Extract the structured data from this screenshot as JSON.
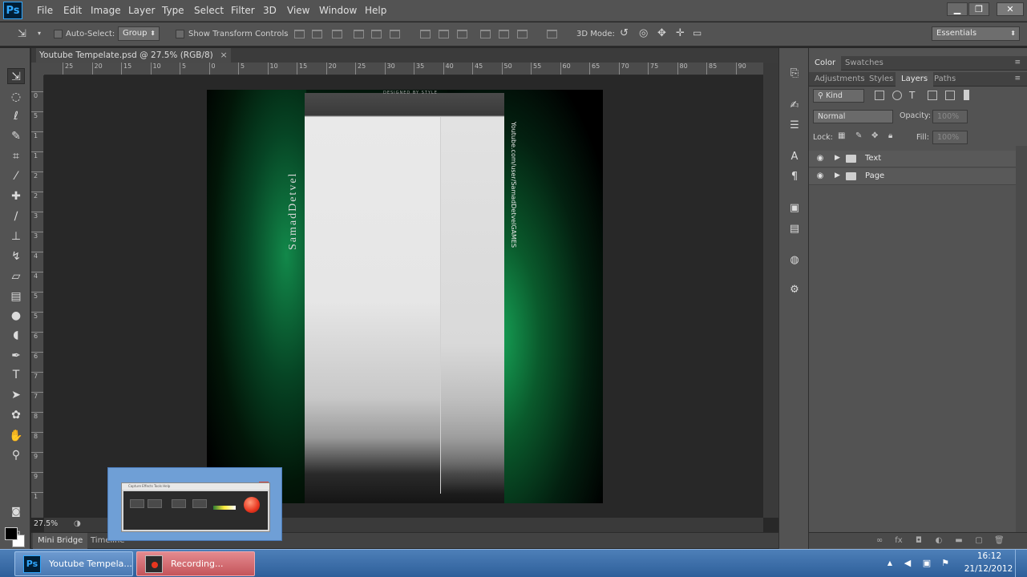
{
  "app": {
    "logo": "Ps"
  },
  "menu": [
    "File",
    "Edit",
    "Image",
    "Layer",
    "Type",
    "Select",
    "Filter",
    "3D",
    "View",
    "Window",
    "Help"
  ],
  "window_controls": {
    "minimize": "▁",
    "restore": "❐",
    "close": "✕"
  },
  "options_bar": {
    "auto_select_label": "Auto-Select:",
    "auto_select_value": "Group",
    "show_transform_label": "Show Transform Controls",
    "mode_3d_label": "3D Mode:",
    "workspace": "Essentials"
  },
  "document": {
    "tab_title": "Youtube Tempelate.psd @ 27.5% (RGB/8)",
    "tab_close": "×",
    "zoom": "27.5%",
    "ruler_h": [
      "25",
      "20",
      "15",
      "10",
      "5",
      "0",
      "5",
      "10",
      "15",
      "20",
      "25",
      "30",
      "35",
      "40",
      "45",
      "50",
      "55",
      "60",
      "65",
      "70",
      "75",
      "80",
      "85",
      "90"
    ],
    "ruler_v": [
      "0",
      "5",
      "1",
      "1",
      "2",
      "2",
      "3",
      "3",
      "4",
      "4",
      "5",
      "5",
      "6",
      "6",
      "7",
      "7",
      "8",
      "8",
      "9",
      "9",
      "1"
    ],
    "artwork": {
      "header_label": "DESIGNED BY STYLE",
      "channel_name": "SamadDetvel",
      "channel_url": "Youtube.com/user/SamadDetvelGAMES"
    }
  },
  "bottom_tabs": [
    "Mini Bridge",
    "Timeline"
  ],
  "panels": {
    "row1_tabs": [
      "Color",
      "Swatches"
    ],
    "row2_tabs": [
      "Adjustments",
      "Styles",
      "Layers",
      "Paths"
    ],
    "active_tab": "Layers",
    "filter_kind": "Kind",
    "blend_mode": "Normal",
    "opacity_label": "Opacity:",
    "opacity_value": "100%",
    "lock_label": "Lock:",
    "fill_label": "Fill:",
    "fill_value": "100%",
    "layers": [
      {
        "name": "Text",
        "type": "group"
      },
      {
        "name": "Page",
        "type": "group"
      }
    ]
  },
  "recorder": {
    "close": "x",
    "menu": "Capture  Effects  Tools  Help"
  },
  "taskbar": {
    "items": [
      {
        "label": "Youtube Tempela...",
        "icon": "photoshop-icon",
        "icon_text": "Ps"
      },
      {
        "label": "Recording...",
        "icon": "recorder-icon"
      }
    ],
    "tray_arrow": "▲",
    "time": "16:12",
    "date": "21/12/2012"
  },
  "colors": {
    "foreground": "#000000",
    "background": "#ffffff",
    "ui_bg": "#535353",
    "taskbar": "#2e5f9a"
  }
}
